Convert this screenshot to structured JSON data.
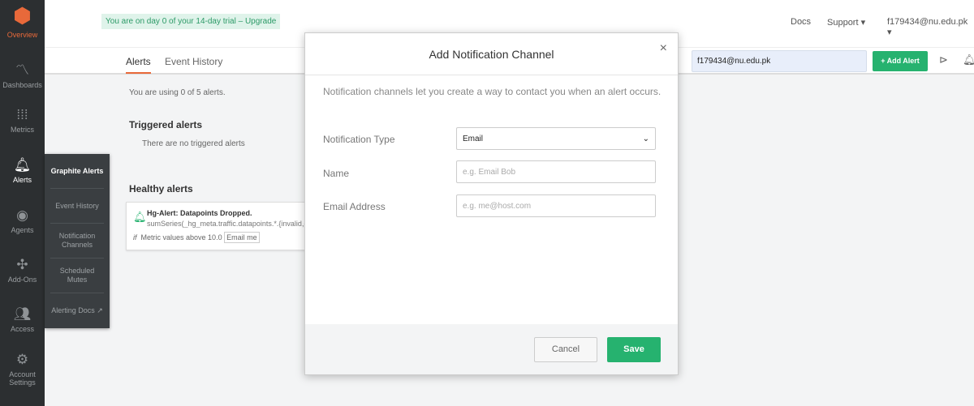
{
  "sidebar": {
    "items": [
      {
        "label": "Overview",
        "icon": "hexagon-logo-icon"
      },
      {
        "label": "Dashboards",
        "icon": "line-chart-icon"
      },
      {
        "label": "Metrics",
        "icon": "sliders-icon"
      },
      {
        "label": "Alerts",
        "icon": "bell-icon"
      },
      {
        "label": "Agents",
        "icon": "eye-icon"
      },
      {
        "label": "Add-Ons",
        "icon": "puzzle-icon"
      },
      {
        "label": "Access",
        "icon": "users-icon"
      },
      {
        "label": "Account Settings",
        "icon": "gear-icon"
      }
    ],
    "flyout": [
      "Graphite Alerts",
      "Event History",
      "Notification Channels",
      "Scheduled Mutes",
      "Alerting Docs ↗"
    ]
  },
  "header": {
    "trial": "You are on day 0 of your 14-day trial – Upgrade",
    "docs": "Docs",
    "support": "Support ▾",
    "user": "f179434@nu.edu.pk ▾"
  },
  "tabs": [
    "Alerts",
    "Event History"
  ],
  "toolbar": {
    "search_value": "f179434@nu.edu.pk",
    "add_alert": "+  Add Alert"
  },
  "main": {
    "usage": "You are using 0 of 5 alerts.",
    "triggered_title": "Triggered alerts",
    "triggered_empty": "There are no triggered alerts",
    "healthy_title": "Healthy alerts",
    "alert": {
      "name": "Hg-Alert: Datapoints Dropped.",
      "query": "sumSeries(_hg_meta.traffic.datapoints.*.{invalid,d",
      "if": "if",
      "condition": "Metric values above 10.0",
      "channel": "Email me"
    }
  },
  "modal": {
    "title": "Add Notification Channel",
    "close": "×",
    "description": "Notification channels let you create a way to contact you when an alert occurs.",
    "type_label": "Notification Type",
    "type_value": "Email",
    "name_label": "Name",
    "name_placeholder": "e.g. Email Bob",
    "email_label": "Email Address",
    "email_placeholder": "e.g. me@host.com",
    "cancel": "Cancel",
    "save": "Save"
  },
  "colors": {
    "accent": "#e8693a",
    "green": "#26b26f",
    "sidebar": "#2c2f31"
  }
}
